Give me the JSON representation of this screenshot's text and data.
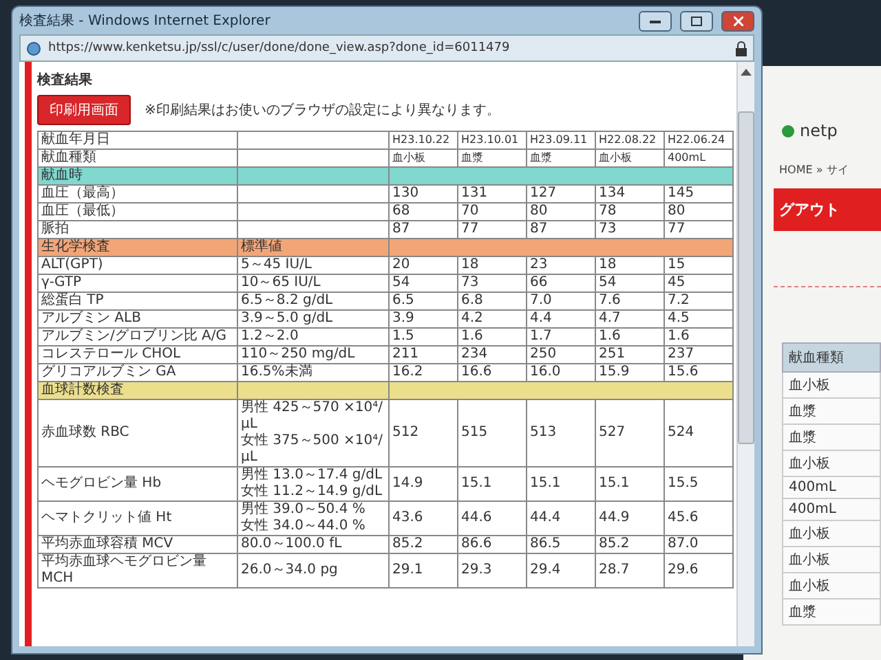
{
  "window": {
    "title": "検査結果 - Windows Internet Explorer",
    "url": "https://www.kenketsu.jp/ssl/c/user/done/done_view.asp?done_id=6011479"
  },
  "page": {
    "heading": "検査結果",
    "print_button": "印刷用画面",
    "note": "※印刷結果はお使いのブラウザの設定により異なります。"
  },
  "table": {
    "rows": [
      {
        "kind": "info",
        "label": "献血年月日",
        "values": [
          "H23.10.22",
          "H23.10.01",
          "H23.09.11",
          "H22.08.22",
          "H22.06.24"
        ]
      },
      {
        "kind": "info",
        "label": "献血種類",
        "values": [
          "血小板",
          "血漿",
          "血漿",
          "血小板",
          "400mL"
        ]
      },
      {
        "kind": "section",
        "label": "献血時",
        "color": "#80d8cf"
      },
      {
        "kind": "item",
        "label": "血圧（最高）",
        "values": [
          "130",
          "131",
          "127",
          "134",
          "145"
        ]
      },
      {
        "kind": "item",
        "label": "血圧（最低）",
        "values": [
          "68",
          "70",
          "80",
          "78",
          "80"
        ]
      },
      {
        "kind": "item",
        "label": "脈拍",
        "values": [
          "87",
          "77",
          "87",
          "73",
          "77"
        ]
      },
      {
        "kind": "section",
        "label": "生化学検査",
        "standard": "標準値",
        "color": "#f2a678"
      },
      {
        "kind": "item",
        "label": "ALT(GPT)",
        "standard": [
          "5～45 IU/L"
        ],
        "values": [
          "20",
          "18",
          "23",
          "18",
          "15"
        ]
      },
      {
        "kind": "item",
        "label": "γ-GTP",
        "standard": [
          "10～65 IU/L"
        ],
        "values": [
          "54",
          "73",
          "66",
          "54",
          "45"
        ]
      },
      {
        "kind": "item",
        "label": "総蛋白 TP",
        "standard": [
          "6.5～8.2 g/dL"
        ],
        "values": [
          "6.5",
          "6.8",
          "7.0",
          "7.6",
          "7.2"
        ]
      },
      {
        "kind": "item",
        "label": "アルブミン ALB",
        "standard": [
          "3.9～5.0 g/dL"
        ],
        "values": [
          "3.9",
          "4.2",
          "4.4",
          "4.7",
          "4.5"
        ]
      },
      {
        "kind": "item",
        "label": "アルブミン/グロブリン比 A/G",
        "standard": [
          "1.2～2.0"
        ],
        "values": [
          "1.5",
          "1.6",
          "1.7",
          "1.6",
          "1.6"
        ]
      },
      {
        "kind": "item",
        "label": "コレステロール CHOL",
        "standard": [
          "110～250 mg/dL"
        ],
        "values": [
          "211",
          "234",
          "250",
          "251",
          "237"
        ]
      },
      {
        "kind": "item",
        "label": "グリコアルブミン GA",
        "standard": [
          "16.5%未満"
        ],
        "values": [
          "16.2",
          "16.6",
          "16.0",
          "15.9",
          "15.6"
        ]
      },
      {
        "kind": "section",
        "label": "血球計数検査",
        "color": "#ebdf8c"
      },
      {
        "kind": "item",
        "label": "赤血球数 RBC",
        "standard": [
          "男性 425～570 ×10⁴/μL",
          "女性 375～500 ×10⁴/μL"
        ],
        "values": [
          "512",
          "515",
          "513",
          "527",
          "524"
        ]
      },
      {
        "kind": "item",
        "label": "ヘモグロビン量 Hb",
        "standard": [
          "男性 13.0～17.4 g/dL",
          "女性 11.2～14.9 g/dL"
        ],
        "values": [
          "14.9",
          "15.1",
          "15.1",
          "15.1",
          "15.5"
        ]
      },
      {
        "kind": "item",
        "label": "ヘマトクリット値 Ht",
        "standard": [
          "男性 39.0～50.4 %",
          "女性 34.0～44.0 %"
        ],
        "values": [
          "43.6",
          "44.6",
          "44.4",
          "44.9",
          "45.6"
        ]
      },
      {
        "kind": "item",
        "label": "平均赤血球容積 MCV",
        "standard": [
          "80.0～100.0 fL"
        ],
        "values": [
          "85.2",
          "86.6",
          "86.5",
          "85.2",
          "87.0"
        ]
      },
      {
        "kind": "item",
        "label": "平均赤血球ヘモグロビン量 MCH",
        "standard": [
          "26.0～34.0 pg"
        ],
        "values": [
          "29.1",
          "29.3",
          "29.4",
          "28.7",
          "29.6"
        ]
      }
    ]
  },
  "background_page": {
    "logo": "netp",
    "breadcrumb": "HOME » サイ",
    "logout": "グアウト",
    "history_header": "献血種類",
    "history_rows": [
      "血小板",
      "血漿",
      "血漿",
      "血小板",
      "400mL",
      "400mL",
      "血小板",
      "血小板",
      "血小板",
      "血漿"
    ]
  }
}
